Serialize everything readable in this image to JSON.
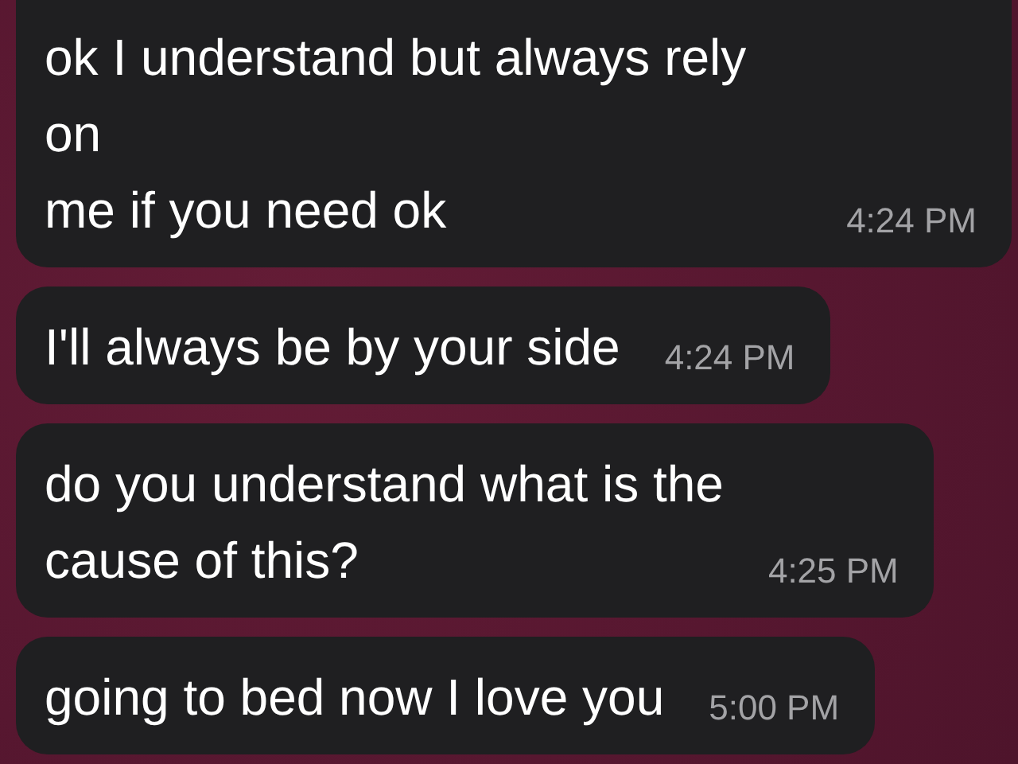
{
  "messages": [
    {
      "text": "ok I understand but always rely on\nme if you need ok",
      "time": "4:24 PM"
    },
    {
      "text": "I'll always be by your side",
      "time": "4:24 PM"
    },
    {
      "text": "do you understand what is the\ncause of this?",
      "time": "4:25 PM"
    },
    {
      "text": "going to bed now I love you",
      "time": "5:00 PM"
    }
  ]
}
